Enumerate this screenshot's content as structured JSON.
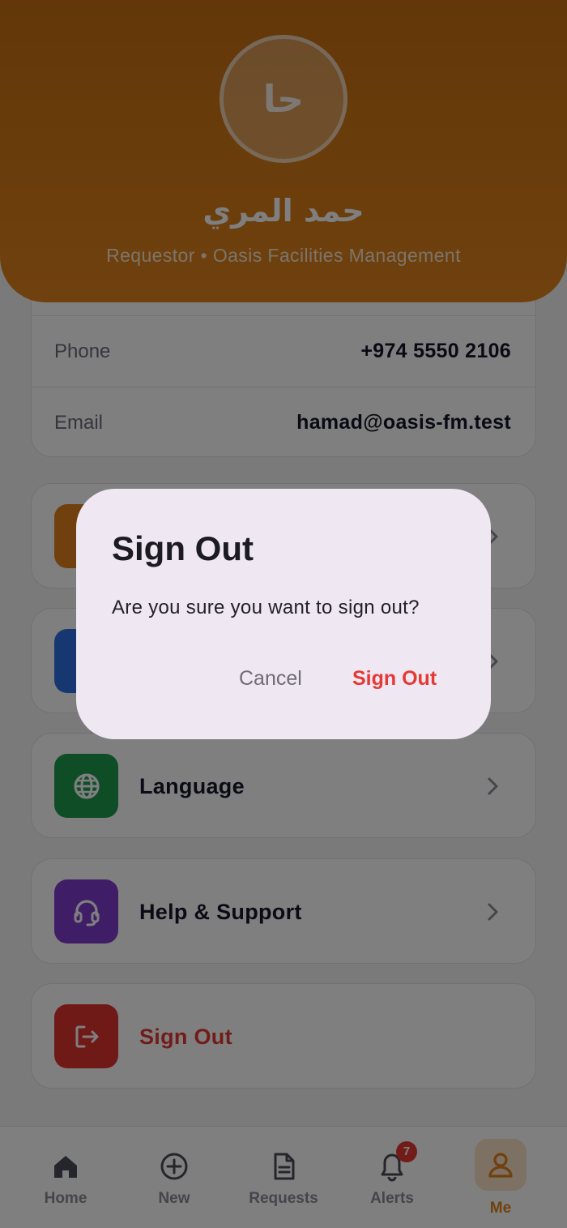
{
  "profile": {
    "avatar_initials": "حا",
    "name": "حمد المري",
    "subtitle": "Requestor • Oasis Facilities Management"
  },
  "info": {
    "phone_label": "Phone",
    "phone_value": "+974 5550 2106",
    "email_label": "Email",
    "email_value": "hamad@oasis-fm.test"
  },
  "menu": {
    "language_label": "Language",
    "help_label": "Help & Support",
    "signout_label": "Sign Out"
  },
  "colors": {
    "header": "#e0831c",
    "language_icon_bg": "#1f9b4f",
    "help_icon_bg": "#7e3ccf",
    "signout_icon_bg": "#e0352f",
    "item1_icon_bg": "#e0831c",
    "item2_icon_bg": "#2f6ee0",
    "danger": "#e53935"
  },
  "nav": {
    "home": "Home",
    "new": "New",
    "requests": "Requests",
    "alerts": "Alerts",
    "me": "Me",
    "alerts_badge": "7"
  },
  "dialog": {
    "title": "Sign Out",
    "message": "Are you sure you want to sign out?",
    "cancel_label": "Cancel",
    "confirm_label": "Sign Out"
  }
}
